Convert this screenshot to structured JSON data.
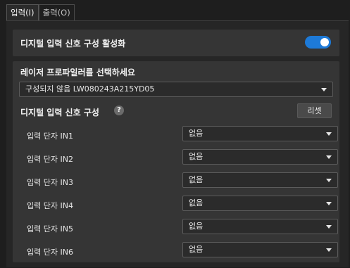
{
  "tabs": [
    {
      "label": "입력(I)",
      "active": true
    },
    {
      "label": "출력(O)",
      "active": false
    }
  ],
  "enable_section": {
    "label": "디지털 입력 신호 구성 활성화",
    "toggle_on": true
  },
  "profiler_section": {
    "heading": "레이저 프로파일러를 선택하세요",
    "selected_profiler": "구성되지 않음 LW080243A215YD05"
  },
  "signal_config": {
    "heading": "디지털 입력 신호 구성",
    "help_icon": "?",
    "reset_label": "리셋",
    "rows": [
      {
        "label": "입력 단자 IN1",
        "value": "없음"
      },
      {
        "label": "입력 단자 IN2",
        "value": "없음"
      },
      {
        "label": "입력 단자 IN3",
        "value": "없음"
      },
      {
        "label": "입력 단자 IN4",
        "value": "없음"
      },
      {
        "label": "입력 단자 IN5",
        "value": "없음"
      },
      {
        "label": "입력 단자 IN6",
        "value": "없음"
      }
    ]
  },
  "colors": {
    "background": "#1e1e1e",
    "card": "#353535",
    "accent_toggle": "#1d7ad8"
  }
}
